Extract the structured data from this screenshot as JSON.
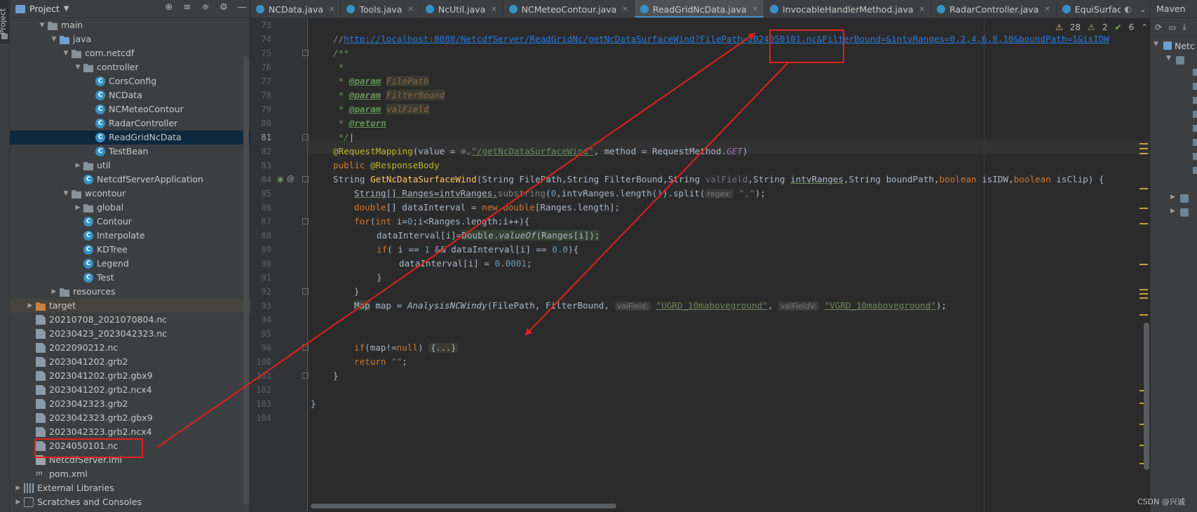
{
  "left_strip": {
    "label": "Project"
  },
  "project_panel": {
    "title": "Project",
    "tree": [
      {
        "label": "main",
        "kind": "folder",
        "depth": 3,
        "expanded": true
      },
      {
        "label": "java",
        "kind": "folder-src",
        "depth": 4,
        "expanded": true
      },
      {
        "label": "com.netcdf",
        "kind": "package",
        "depth": 5,
        "expanded": true
      },
      {
        "label": "controller",
        "kind": "package",
        "depth": 6,
        "expanded": true
      },
      {
        "label": "CorsConfig",
        "kind": "class",
        "depth": 7
      },
      {
        "label": "NCData",
        "kind": "class",
        "depth": 7
      },
      {
        "label": "NCMeteoContour",
        "kind": "class",
        "depth": 7
      },
      {
        "label": "RadarController",
        "kind": "class",
        "depth": 7
      },
      {
        "label": "ReadGridNcData",
        "kind": "class",
        "depth": 7,
        "selected": true
      },
      {
        "label": "TestBean",
        "kind": "class",
        "depth": 7
      },
      {
        "label": "util",
        "kind": "package",
        "depth": 6,
        "expanded": false
      },
      {
        "label": "NetcdfServerApplication",
        "kind": "class",
        "depth": 6
      },
      {
        "label": "wcontour",
        "kind": "package",
        "depth": 5,
        "expanded": true
      },
      {
        "label": "global",
        "kind": "package",
        "depth": 6,
        "expanded": false
      },
      {
        "label": "Contour",
        "kind": "class",
        "depth": 6
      },
      {
        "label": "Interpolate",
        "kind": "class",
        "depth": 6
      },
      {
        "label": "KDTree",
        "kind": "class",
        "depth": 6
      },
      {
        "label": "Legend",
        "kind": "class",
        "depth": 6
      },
      {
        "label": "Test",
        "kind": "class",
        "depth": 6
      },
      {
        "label": "resources",
        "kind": "folder-res",
        "depth": 4,
        "expanded": false
      },
      {
        "label": "target",
        "kind": "folder-orange",
        "depth": 2,
        "expanded": false,
        "highlighted": true
      },
      {
        "label": "20210708_2021070804.nc",
        "kind": "file",
        "depth": 2
      },
      {
        "label": "20230423_2023042323.nc",
        "kind": "file",
        "depth": 2
      },
      {
        "label": "2022090212.nc",
        "kind": "file",
        "depth": 2
      },
      {
        "label": "2023041202.grb2",
        "kind": "file",
        "depth": 2
      },
      {
        "label": "2023041202.grb2.gbx9",
        "kind": "file",
        "depth": 2
      },
      {
        "label": "2023041202.grb2.ncx4",
        "kind": "file",
        "depth": 2
      },
      {
        "label": "2023042323.grb2",
        "kind": "file",
        "depth": 2
      },
      {
        "label": "2023042323.grb2.gbx9",
        "kind": "file",
        "depth": 2
      },
      {
        "label": "2023042323.grb2.ncx4",
        "kind": "file",
        "depth": 2
      },
      {
        "label": "2024050101.nc",
        "kind": "file",
        "depth": 2
      },
      {
        "label": "NetcdfServer.iml",
        "kind": "iml",
        "depth": 2
      },
      {
        "label": "pom.xml",
        "kind": "pom",
        "depth": 2
      },
      {
        "label": "External Libraries",
        "kind": "libs",
        "depth": 1,
        "expanded": false
      },
      {
        "label": "Scratches and Consoles",
        "kind": "scratch",
        "depth": 1,
        "expanded": false
      }
    ]
  },
  "tabs": [
    {
      "label": "NCData.java",
      "active": false
    },
    {
      "label": "Tools.java",
      "active": false
    },
    {
      "label": "NcUtil.java",
      "active": false
    },
    {
      "label": "NCMeteoContour.java",
      "active": false
    },
    {
      "label": "ReadGridNcData.java",
      "active": true
    },
    {
      "label": "InvocableHandlerMethod.java",
      "active": false,
      "readonly": true
    },
    {
      "label": "RadarController.java",
      "active": false
    },
    {
      "label": "EquiSurface.java",
      "active": false
    }
  ],
  "inspections": {
    "warnings": "28",
    "weak_warnings": "2",
    "ok": "6"
  },
  "code": {
    "line_numbers": [
      "73",
      "74",
      "75",
      "76",
      "77",
      "78",
      "79",
      "80",
      "81",
      "82",
      "83",
      "84",
      "85",
      "86",
      "87",
      "88",
      "89",
      "90",
      "91",
      "92",
      "93",
      "94",
      "95",
      "96",
      "100",
      "101",
      "102",
      "103",
      "104"
    ],
    "url_comment_prefix": "//",
    "url": "http://localhost:8088/NetcdfServer/ReadGridNc/getNcDataSurfaceWind?FilePath=2024050101.nc&FilterBound=&intvRanges=0,2,4,6,8,10&boundPath=1&isIDW",
    "doc_open": "/**",
    "doc_star": " *",
    "doc_param_tag": "@param",
    "doc_return_tag": "@return",
    "doc_param_1": "FilePath",
    "doc_param_2": "FilterBound",
    "doc_param_3": "valField",
    "doc_close": " */",
    "mapping_annotation": "@RequestMapping",
    "mapping_value_kw": "value = ",
    "mapping_path": "\"/getNcDataSurfaceWind\"",
    "mapping_method_kw": ", method = RequestMethod.",
    "mapping_method_val": "GET",
    "public_kw": "public",
    "response_body": "@ResponseBody",
    "signature_type": "String ",
    "signature_name": "GetNcDataSurfaceWind",
    "signature_p1": "(String FilePath,String FilterBound,String ",
    "signature_unused": "valField",
    "signature_p2": ",String ",
    "signature_intv": "intvRanges",
    "signature_p3": ",String boundPath,",
    "signature_bool": "boolean",
    "signature_p4": " isIDW,",
    "signature_p5": " isClip) {",
    "l85_a": "String[] ",
    "l85_b": "Ranges=intvRanges.",
    "l85_sub": "substring",
    "l85_c": "(",
    "l85_zero": "0",
    "l85_d": ",intvRanges.length()).split(",
    "l85_hint": "regex:",
    "l85_str": "\",\"",
    "l85_e": ");",
    "l86_type": "double",
    "l86_a": "[] dataInterval = ",
    "l86_new": "new ",
    "l86_b": "[Ranges.length];",
    "l87_for": "for",
    "l87_a": "(",
    "l87_int": "int ",
    "l87_b": "i=",
    "l87_zero": "0",
    "l87_c": ";i<Ranges.length;i++){",
    "l88_a": "dataInterval[i]=",
    "l88_b": "Double.",
    "l88_c": "valueOf",
    "l88_d": "(Ranges[i]);",
    "l89_if": "if",
    "l89_a": "( i == ",
    "l89_one": "1",
    "l89_b": " && dataInterval[i] == ",
    "l89_zero": "0.0",
    "l89_c": "){",
    "l90_a": "dataInterval[i] = ",
    "l90_num": "0.0001",
    "l90_b": ";",
    "brace_close": "}",
    "l93_map": "Map",
    "l93_a": " map = ",
    "l93_call": "AnalysisNCWindy",
    "l93_b": "(FilePath, FilterBound, ",
    "l93_hint1": "valField:",
    "l93_str1": "\"UGRD_10maboveground\"",
    "l93_c": ", ",
    "l93_hint2": "valFieldV:",
    "l93_str2": "\"VGRD_10maboveground\"",
    "l93_d": ");",
    "l96_if": "if",
    "l96_a": "(map!=",
    "l96_null": "null",
    "l96_b": ") ",
    "l96_fold": "{...}",
    "l100_return": "return ",
    "l100_str": "\"\"",
    "l100_end": ";"
  },
  "maven": {
    "title": "Maven",
    "root": "Netc"
  },
  "watermark": "CSDN @兴诚",
  "colors": {
    "annotation_red": "#e0211c",
    "selection": "#0d293e",
    "accent_tab": "#4a88c7"
  }
}
